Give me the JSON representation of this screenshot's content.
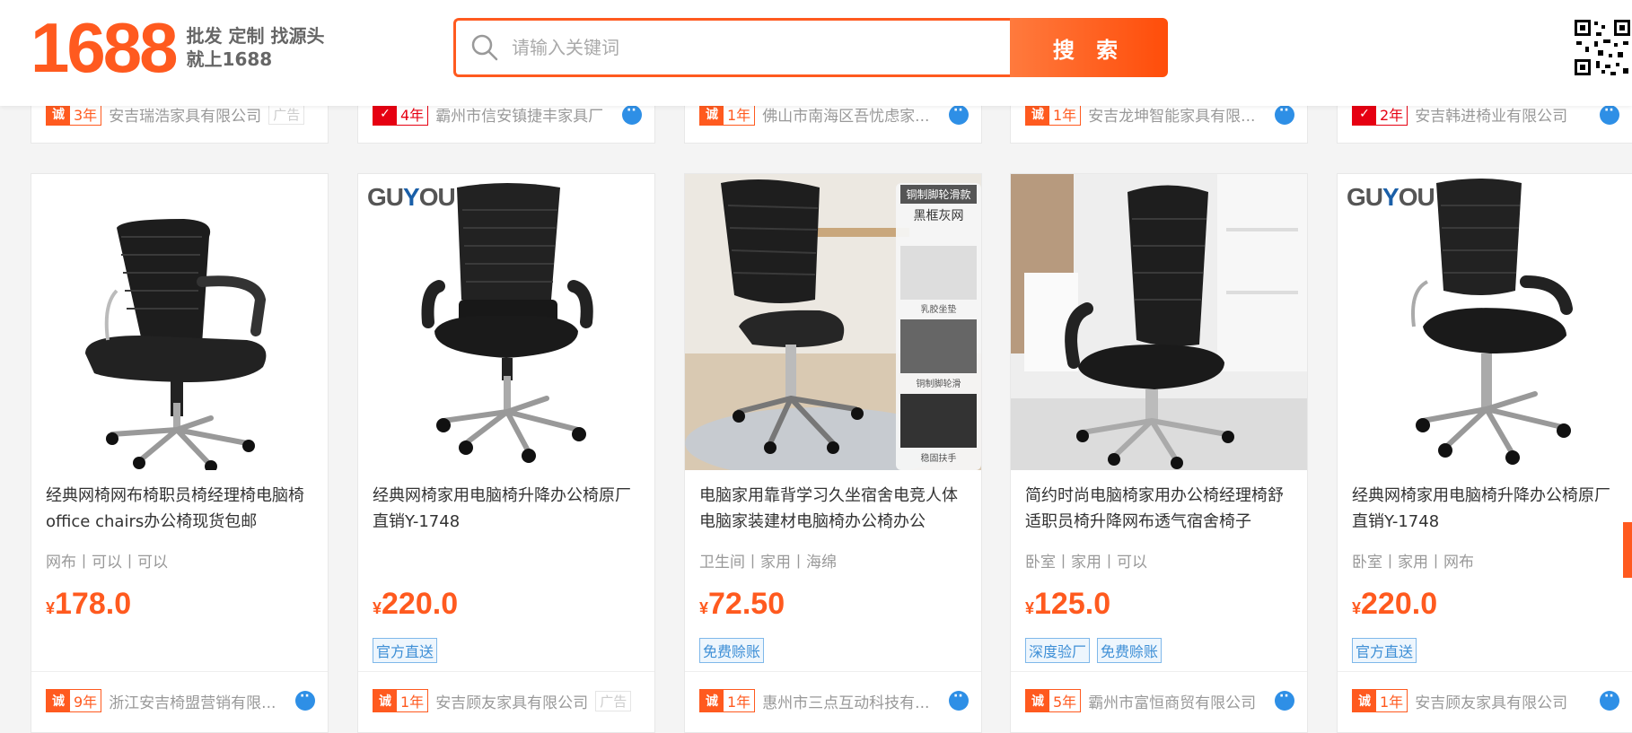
{
  "header": {
    "logo_text": "1688",
    "slogan_line1": "批发 定制 找源头",
    "slogan_line2": "就上1688",
    "search_placeholder": "请输入关键词",
    "search_button": "搜 索"
  },
  "top_row": [
    {
      "years": "3年",
      "shop": "安吉瑞浩家具有限公司",
      "ad": "广告",
      "badge": "诚"
    },
    {
      "years": "4年",
      "shop": "霸州市信安镇捷丰家具厂",
      "ad": "",
      "badge": "✓"
    },
    {
      "years": "1年",
      "shop": "佛山市南海区吾忧虑家...",
      "ad": "",
      "badge": "诚"
    },
    {
      "years": "1年",
      "shop": "安吉龙坤智能家具有限...",
      "ad": "",
      "badge": "诚"
    },
    {
      "years": "2年",
      "shop": "安吉韩进椅业有限公司",
      "ad": "",
      "badge": "✓"
    }
  ],
  "products": [
    {
      "title": "经典网椅网布椅职员椅经理椅电脑椅office chairs办公椅现货包邮",
      "props": "网布丨可以丨可以",
      "currency": "¥",
      "price": "178.0",
      "tags": [],
      "years": "9年",
      "shop": "浙江安吉椅盟营销有限...",
      "ad": "",
      "brand": ""
    },
    {
      "title": "经典网椅家用电脑椅升降办公椅原厂直销Y-1748",
      "props": "",
      "currency": "¥",
      "price": "220.0",
      "tags": [
        "官方直送"
      ],
      "years": "1年",
      "shop": "安吉顾友家具有限公司",
      "ad": "广告",
      "brand": "GUYOU"
    },
    {
      "title": "电脑家用靠背学习久坐宿舍电竞人体电脑家装建材电脑椅办公椅办公",
      "props": "卫生间丨家用丨海绵",
      "currency": "¥",
      "price": "72.50",
      "tags": [
        "免费赊账"
      ],
      "years": "1年",
      "shop": "惠州市三点互动科技有...",
      "ad": "",
      "brand": "",
      "overlay": {
        "title": "铜制脚轮滑款",
        "sub": "黑框灰网",
        "labels": [
          "乳胶坐垫",
          "铜制脚轮滑",
          "稳固扶手"
        ]
      }
    },
    {
      "title": "简约时尚电脑椅家用办公椅经理椅舒适职员椅升降网布透气宿舍椅子",
      "props": "卧室丨家用丨可以",
      "currency": "¥",
      "price": "125.0",
      "tags": [
        "深度验厂",
        "免费赊账"
      ],
      "years": "5年",
      "shop": "霸州市富恒商贸有限公司",
      "ad": "",
      "brand": ""
    },
    {
      "title": "经典网椅家用电脑椅升降办公椅原厂直销Y-1748",
      "props": "卧室丨家用丨网布",
      "currency": "¥",
      "price": "220.0",
      "tags": [
        "官方直送"
      ],
      "years": "1年",
      "shop": "安吉顾友家具有限公司",
      "ad": "",
      "brand": "GUYOU"
    }
  ],
  "colors": {
    "accent": "#ff5a1f",
    "tag_blue": "#3e8fd6",
    "chat_blue": "#2e8fe6"
  }
}
